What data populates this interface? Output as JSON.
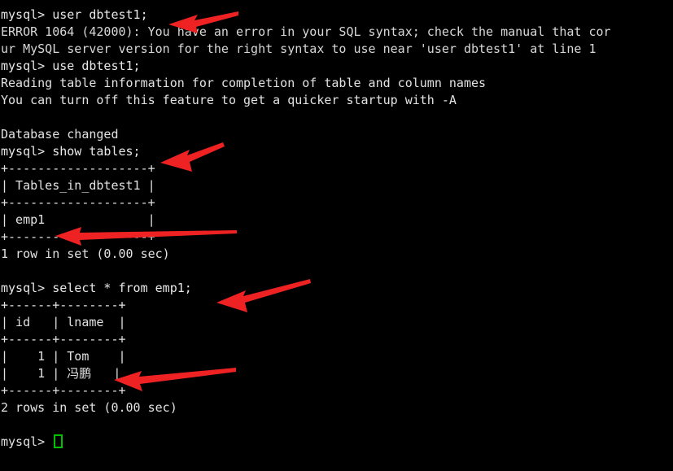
{
  "terminal": {
    "title": "mysql client session",
    "background_color": "#000000",
    "text_color": "#e2e2e2",
    "cursor_color": "#00c000",
    "annotation_color": "#ee2222",
    "prompt": "mysql>",
    "lines": [
      {
        "id": "l01",
        "text": "mysql> user dbtest1;",
        "kind": "prompt"
      },
      {
        "id": "l02",
        "text": "ERROR 1064 (42000): You have an error in your SQL syntax; check the manual that cor",
        "kind": "error"
      },
      {
        "id": "l03",
        "text": "ur MySQL server version for the right syntax to use near 'user dbtest1' at line 1",
        "kind": "error"
      },
      {
        "id": "l04",
        "text": "mysql> use dbtest1;",
        "kind": "prompt"
      },
      {
        "id": "l05",
        "text": "Reading table information for completion of table and column names",
        "kind": "output"
      },
      {
        "id": "l06",
        "text": "You can turn off this feature to get a quicker startup with -A",
        "kind": "output"
      },
      {
        "id": "l07",
        "text": "",
        "kind": "blank"
      },
      {
        "id": "l08",
        "text": "Database changed",
        "kind": "output"
      },
      {
        "id": "l09",
        "text": "mysql> show tables;",
        "kind": "prompt"
      },
      {
        "id": "l10",
        "text": "+-------------------+",
        "kind": "table"
      },
      {
        "id": "l11",
        "text": "| Tables_in_dbtest1 |",
        "kind": "table"
      },
      {
        "id": "l12",
        "text": "+-------------------+",
        "kind": "table"
      },
      {
        "id": "l13",
        "text": "| emp1              |",
        "kind": "table"
      },
      {
        "id": "l14",
        "text": "+-------------------+",
        "kind": "table"
      },
      {
        "id": "l15",
        "text": "1 row in set (0.00 sec)",
        "kind": "output"
      },
      {
        "id": "l16",
        "text": "",
        "kind": "blank"
      },
      {
        "id": "l17",
        "text": "mysql> select * from emp1;",
        "kind": "prompt"
      },
      {
        "id": "l18",
        "text": "+------+--------+",
        "kind": "table"
      },
      {
        "id": "l19",
        "text": "| id   | lname  |",
        "kind": "table"
      },
      {
        "id": "l20",
        "text": "+------+--------+",
        "kind": "table"
      },
      {
        "id": "l21",
        "text": "|    1 | Tom    |",
        "kind": "table"
      },
      {
        "id": "l22",
        "text": "|    1 | 冯鹏   |",
        "kind": "table"
      },
      {
        "id": "l23",
        "text": "+------+--------+",
        "kind": "table"
      },
      {
        "id": "l24",
        "text": "2 rows in set (0.00 sec)",
        "kind": "output"
      },
      {
        "id": "l25",
        "text": "",
        "kind": "blank"
      },
      {
        "id": "l26",
        "text": "mysql> ",
        "kind": "cursor"
      }
    ],
    "results": {
      "show_tables": {
        "columns": [
          "Tables_in_dbtest1"
        ],
        "rows": [
          [
            "emp1"
          ]
        ],
        "footer": "1 row in set (0.00 sec)"
      },
      "select_emp1": {
        "columns": [
          "id",
          "lname"
        ],
        "rows": [
          [
            "1",
            "Tom"
          ],
          [
            "1",
            "冯鹏"
          ]
        ],
        "footer": "2 rows in set (0.00 sec)"
      }
    },
    "annotations": [
      {
        "id": "a1",
        "name": "arrow-to-user-statement",
        "target": "mysql> user dbtest1;"
      },
      {
        "id": "a2",
        "name": "arrow-to-show-tables",
        "target": "mysql> show tables;"
      },
      {
        "id": "a3",
        "name": "arrow-to-emp1-row",
        "target": "emp1"
      },
      {
        "id": "a4",
        "name": "arrow-to-select-statement",
        "target": "mysql> select * from emp1;"
      },
      {
        "id": "a5",
        "name": "arrow-to-chinese-name-row",
        "target": "冯鹏"
      }
    ]
  }
}
